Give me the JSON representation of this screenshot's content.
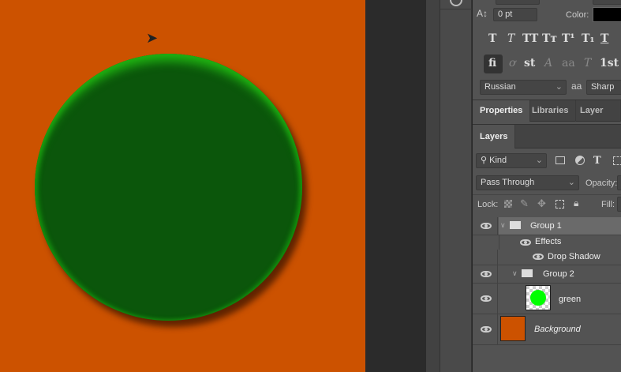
{
  "canvas": {
    "background": "#cc5200",
    "circle_color": "#0b560b"
  },
  "character": {
    "tracking_value": "0 pt",
    "color_label": "Color:",
    "language": "Russian",
    "aa_icon": "aa",
    "antialias": "Sharp",
    "style_buttons": [
      "T",
      "T",
      "TT",
      "Tт",
      "T¹",
      "T₁",
      "T"
    ],
    "opentype_buttons": [
      "fi",
      "ơ",
      "st",
      "A",
      "aa",
      "T",
      "1st"
    ]
  },
  "tabs": [
    "Properties",
    "Libraries",
    "Layer Comp"
  ],
  "layers": {
    "tab": "Layers",
    "filter": "Kind",
    "blend_mode": "Pass Through",
    "opacity_label": "Opacity:",
    "lock_label": "Lock:",
    "fill_label": "Fill:",
    "items": [
      {
        "name": "Group 1"
      },
      {
        "name": "Effects"
      },
      {
        "name": "Drop Shadow"
      },
      {
        "name": "Group 2"
      },
      {
        "name": "green"
      },
      {
        "name": "Background"
      }
    ]
  }
}
